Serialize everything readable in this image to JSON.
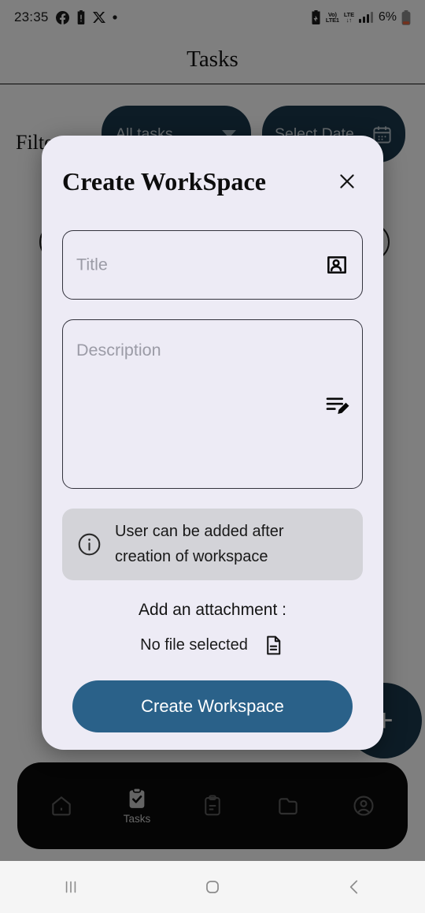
{
  "status_bar": {
    "time": "23:35",
    "left_icons": [
      "facebook-icon",
      "battery-alert-icon",
      "x-twitter-icon",
      "dot-icon"
    ],
    "network_volte": "Vo)",
    "network_volte_sub": "LTE1",
    "network_lte": "LTE",
    "network_data_arrows": "↓↑",
    "battery_percent": "6%",
    "right_icons": [
      "battery-saver-icon",
      "signal-bars-icon",
      "battery-icon"
    ]
  },
  "app": {
    "header_title": "Tasks",
    "filter_label": "Filter",
    "all_tasks_pill": "All tasks",
    "select_date_pill": "Select Date",
    "fab_label": "+",
    "bottom_nav": [
      {
        "label": "",
        "icon": "home-icon",
        "active": false
      },
      {
        "label": "Tasks",
        "icon": "clipboard-check-icon",
        "active": true
      },
      {
        "label": "",
        "icon": "clipboard-list-icon",
        "active": false
      },
      {
        "label": "",
        "icon": "folder-icon",
        "active": false
      },
      {
        "label": "",
        "icon": "account-circle-icon",
        "active": false
      }
    ]
  },
  "modal": {
    "title": "Create WorkSpace",
    "close_icon": "close-icon",
    "title_field": {
      "placeholder": "Title",
      "value": "",
      "icon": "contact-card-icon"
    },
    "description_field": {
      "placeholder": "Description",
      "value": "",
      "icon": "edit-note-icon"
    },
    "info_notice": {
      "icon": "info-circle-icon",
      "line1": "User can be added after",
      "line2": "creation of workspace"
    },
    "attachment": {
      "heading": "Add an attachment :",
      "file_status": "No file selected",
      "icon": "document-icon"
    },
    "submit_label": "Create Workspace"
  },
  "system_nav": {
    "recents_icon": "recents-icon",
    "home_icon": "home-square-icon",
    "back_icon": "back-chevron-icon"
  },
  "colors": {
    "modal_bg": "#EDEBF5",
    "primary_button": "#2A6189",
    "pill_dark_blue": "#1B384D",
    "info_box_bg": "#D3D3D8",
    "nav_bar_bg": "#0B0B0B",
    "system_nav_bg": "#F5F5F5",
    "battery_warning": "#E8633A"
  }
}
